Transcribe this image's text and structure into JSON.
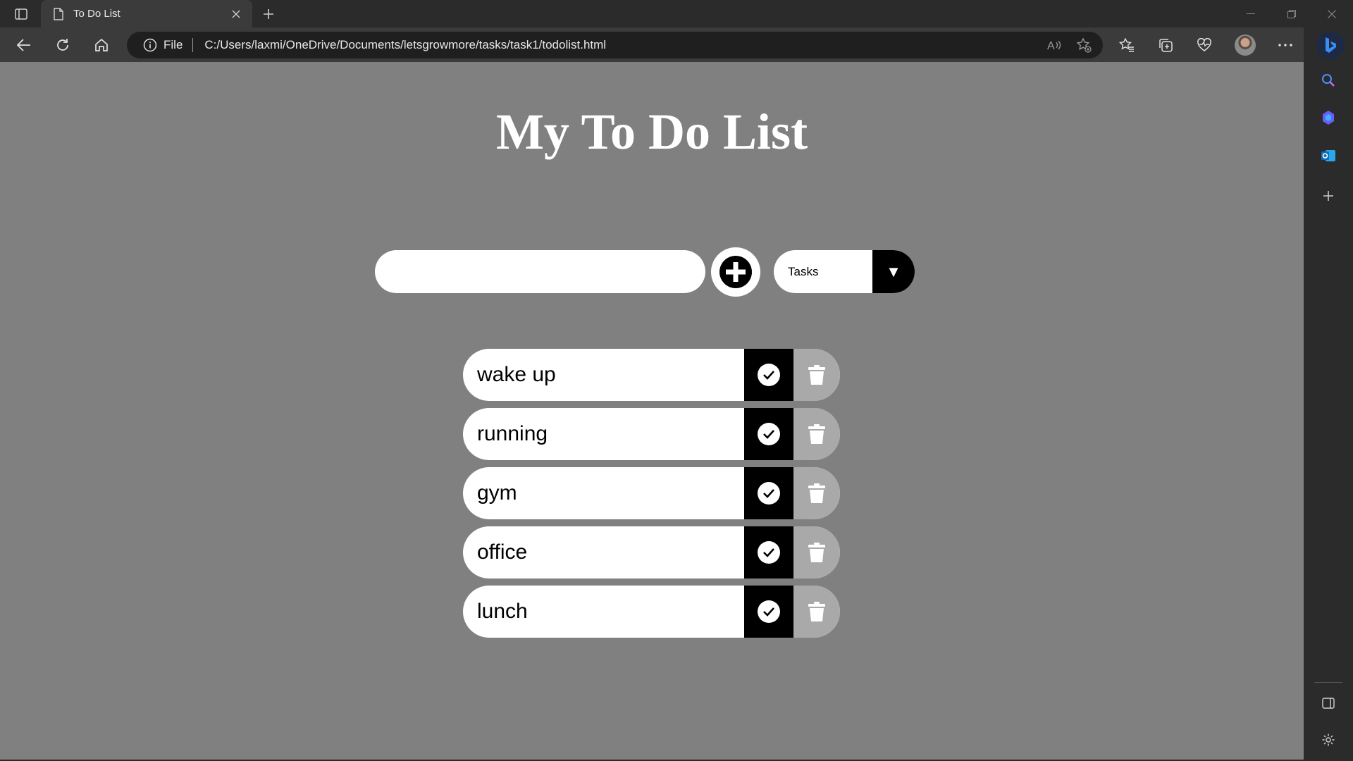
{
  "browser": {
    "tab_title": "To Do List",
    "address_scheme": "File",
    "address_url": "C:/Users/laxmi/OneDrive/Documents/letsgrowmore/tasks/task1/todolist.html"
  },
  "page": {
    "title": "My To Do List",
    "input_value": "",
    "filter_selected": "Tasks",
    "filter_arrow": "▼",
    "todos": [
      {
        "text": "wake up"
      },
      {
        "text": "running"
      },
      {
        "text": "gym"
      },
      {
        "text": "office"
      },
      {
        "text": "lunch"
      }
    ]
  },
  "colors": {
    "page_background": "#808080",
    "complete_button": "#000000",
    "trash_button": "#a9a9a9",
    "browser_chrome": "#2b2b2b"
  }
}
